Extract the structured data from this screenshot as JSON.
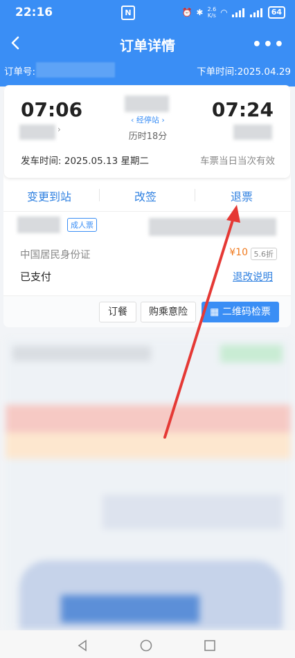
{
  "status_bar": {
    "time": "22:16",
    "net_speed_top": "2.6",
    "net_speed_bottom": "K/s",
    "battery": "64"
  },
  "nav": {
    "title": "订单详情",
    "more": "•••"
  },
  "order": {
    "number_label": "订单号:",
    "order_time": "下单时间:2025.04.29"
  },
  "trip": {
    "depart_time": "07:06",
    "arrive_time": "07:24",
    "via_label": "经停站",
    "duration": "历时18分",
    "depart_date_label": "发车时间:",
    "depart_date": "2025.05.13 星期二",
    "validity": "车票当日当次有效"
  },
  "actions": {
    "change_station": "变更到站",
    "reschedule": "改签",
    "refund": "退票"
  },
  "passenger": {
    "ticket_type": "成人票",
    "id_type": "中国居民身份证",
    "price": "¥10",
    "discount": "5.6折",
    "payment_status": "已支付",
    "refund_rules": "退改说明"
  },
  "buttons": {
    "meal": "订餐",
    "insurance": "购乘意险",
    "qr_check": "二维码检票"
  },
  "colors": {
    "brand_blue": "#3a8ef5",
    "link_blue": "#2d7fe0",
    "price_orange": "#f07a1e",
    "annotation_red": "#e53935"
  }
}
